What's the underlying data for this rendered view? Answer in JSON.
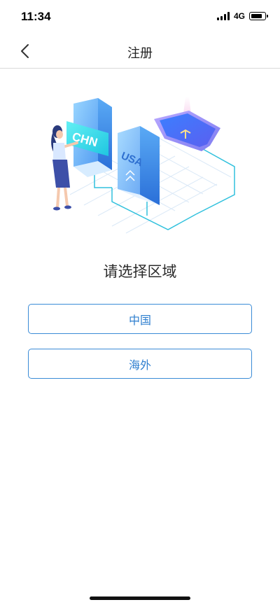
{
  "status": {
    "time": "11:34",
    "network": "4G"
  },
  "nav": {
    "title": "注册",
    "back_icon": "chevron-left-icon"
  },
  "illustration": {
    "sign_left": "CHN",
    "sign_right": "USA"
  },
  "main": {
    "heading": "请选择区域",
    "options": [
      {
        "label": "中国"
      },
      {
        "label": "海外"
      }
    ]
  },
  "colors": {
    "accent": "#3a8bd6",
    "accent_text": "#2f7fcf",
    "divider": "#d9d9d9"
  }
}
